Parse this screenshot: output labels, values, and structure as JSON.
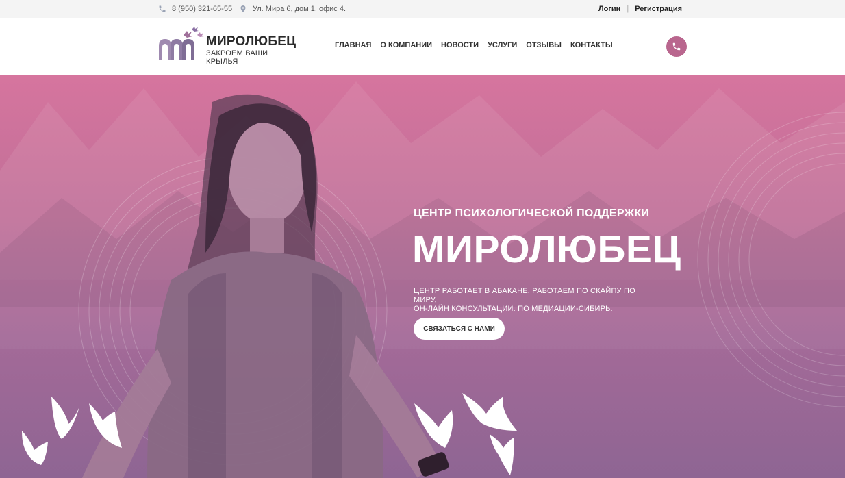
{
  "topbar": {
    "phone": "8 (950) 321-65-55",
    "address": "Ул. Мира 6, дом 1, офис 4.",
    "login": "Логин",
    "separator": "|",
    "register": "Регистрация"
  },
  "logo": {
    "title": "МИРОЛЮБЕЦ",
    "subtitle": "ЗАКРОЕМ ВАШИ КРЫЛЬЯ"
  },
  "nav": {
    "items": [
      "ГЛАВНАЯ",
      "О КОМПАНИИ",
      "НОВОСТИ",
      "УСЛУГИ",
      "ОТЗЫВЫ",
      "КОНТАКТЫ"
    ]
  },
  "hero": {
    "subtitle": "ЦЕНТР ПСИХОЛОГИЧЕСКОЙ ПОДДЕРЖКИ",
    "title": "МИРОЛЮБЕЦ",
    "text_line1": "ЦЕНТР РАБОТАЕТ В АБАКАНЕ. РАБОТАЕМ ПО СКАЙПУ ПО МИРУ,",
    "text_line2": "ОН-ЛАЙН КОНСУЛЬТАЦИИ. ПО МЕДИАЦИИ-СИБИРЬ.",
    "cta": "СВЯЗАТЬСЯ С НАМИ"
  },
  "colors": {
    "accent": "#b9668e",
    "hero_top": "#d6759e",
    "hero_bottom": "#8e6593"
  },
  "icons": {
    "phone": "phone-icon",
    "location": "location-pin-icon",
    "call": "call-button-icon"
  }
}
